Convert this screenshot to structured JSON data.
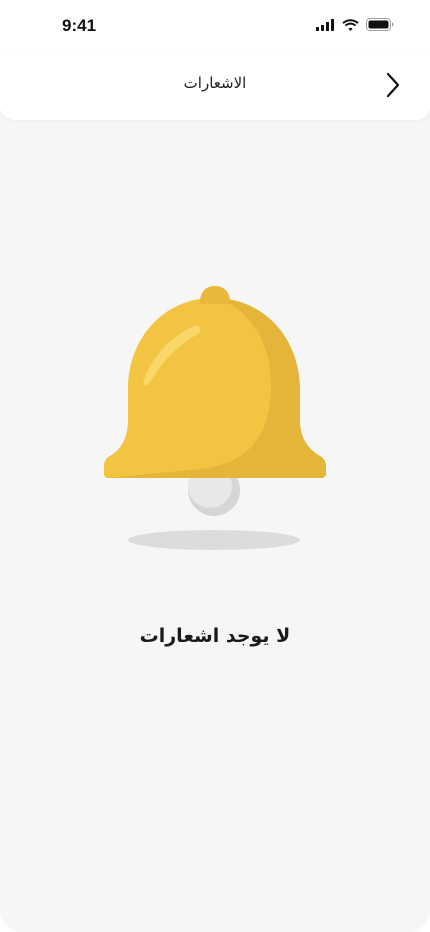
{
  "status_bar": {
    "time": "9:41",
    "icons": [
      "cellular-signal-icon",
      "wifi-icon",
      "battery-icon"
    ]
  },
  "header": {
    "title": "الاشعارات",
    "back_icon": "chevron-right-icon"
  },
  "empty_state": {
    "illustration_icon": "bell-icon",
    "message": "لا يوجد اشعارات"
  },
  "colors": {
    "bell_main": "#F2C442",
    "bell_shade": "#E5B53A",
    "background": "#F6F6F6",
    "surface": "#FFFFFF"
  }
}
